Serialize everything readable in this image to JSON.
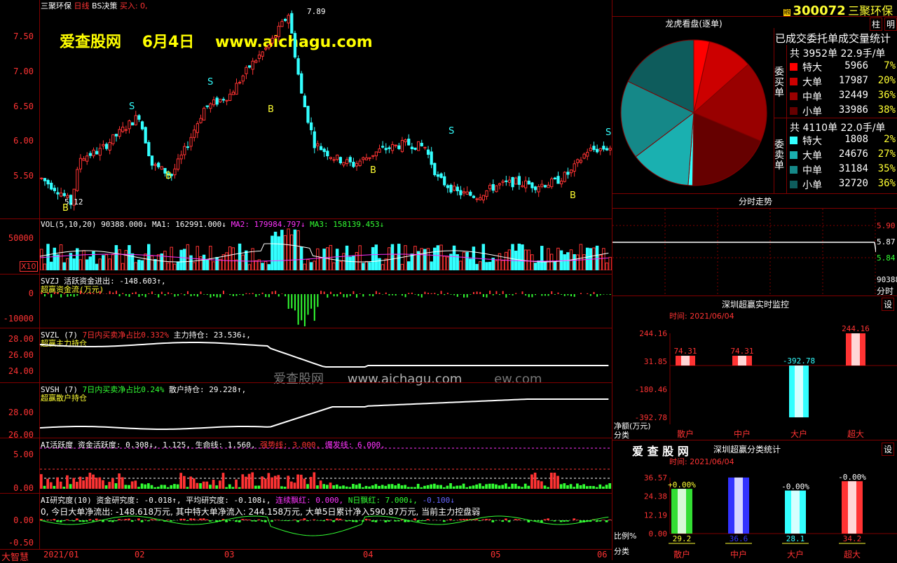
{
  "header": {
    "stock_name": "三聚环保",
    "period": "日线",
    "decision": "BS决策",
    "buy_signal": "买入: 0,",
    "watermark_title": "爱查股网",
    "watermark_date": "6月4日",
    "watermark_url": "www.aichagu.com",
    "center_watermark": "爱查股网",
    "center_watermark_url": "www.aichagu.com",
    "center_watermark_tail": "ew.com",
    "high_label": "7.89",
    "low_label": "5.12"
  },
  "main_chart": {
    "y_ticks": [
      "7.50",
      "7.00",
      "6.50",
      "6.00",
      "5.50"
    ],
    "signals_s": [
      "S",
      "S",
      "S",
      "S"
    ],
    "signals_b": [
      "B",
      "B",
      "B",
      "B",
      "B"
    ]
  },
  "vol_panel": {
    "name": "VOL(5,10,20)",
    "value": "90388.000↓",
    "ma1": "MA1: 162991.000↓",
    "ma2": "MA2: 179984.797↓",
    "ma3": "MA3: 158139.453↓",
    "y_ticks": [
      "50000"
    ],
    "unit": "X10"
  },
  "svzj_panel": {
    "name": "SVZJ",
    "line": "活跃资金进出: -148.603↑,",
    "sub": "超赢资金流(万元)",
    "y_ticks": [
      "0",
      "-10000"
    ]
  },
  "svzl_panel": {
    "name": "SVZL (7)",
    "line1": "7日内买卖净占比0.332%",
    "line2": "主力持仓: 23.536↓,",
    "sub": "超赢主力持仓",
    "y_ticks": [
      "28.00",
      "26.00",
      "24.00"
    ]
  },
  "svsh_panel": {
    "name": "SVSH (7)",
    "line1": "7日内买卖净占比0.24%",
    "line2": "散户持仓: 29.228↑,",
    "sub": "超赢散户持仓",
    "y_ticks": [
      "28.00",
      "26.00"
    ]
  },
  "ai_active": {
    "name": "AI活跃度",
    "v1": "资金活跃度: 0.308↓,",
    "v2": "1.125,",
    "v3": "生命线: 1.560,",
    "v4": "强势线: 3.000,",
    "v5": "爆发线: 6.000,",
    "y_ticks": [
      "5.00",
      "0.00"
    ]
  },
  "ai_research": {
    "name": "AI研究度(10)",
    "v1": "资金研究度: -0.018↑,",
    "v2": "平均研究度: -0.108↓,",
    "v3": "连续飘红: 0.000,",
    "v4": "N日飘红: 7.000↓,",
    "v5": "-0.100↓",
    "summary": "0, 今日大单净流出: -148.618万元, 其中特大单净流入: 244.158万元, 大单5日累计净入590.87万元, 当前主力控盘弱",
    "y_ticks": [
      "0.00",
      "-0.50"
    ]
  },
  "x_axis": {
    "corner": "大智慧",
    "labels": [
      "2021/01",
      "02",
      "03",
      "04",
      "05",
      "06"
    ]
  },
  "right_panel": {
    "code_badge": "融",
    "code": "300072",
    "name": "三聚环保",
    "tab1": "柱",
    "tab2": "明",
    "pie_title": "龙虎看盘(逐单)",
    "stat_title": "已成交委托单成交量统计",
    "buy_side_label": "委买单",
    "sell_side_label": "委卖单",
    "buy_total": "共 3952单 22.9手/单",
    "sell_total": "共 4110单 22.0手/单",
    "buy_rows": [
      {
        "label": "特大",
        "num": "5966",
        "pct": "7%",
        "color": "#ff0000"
      },
      {
        "label": "大单",
        "num": "17987",
        "pct": "20%",
        "color": "#cc0000"
      },
      {
        "label": "中单",
        "num": "32449",
        "pct": "36%",
        "color": "#990000"
      },
      {
        "label": "小单",
        "num": "33986",
        "pct": "38%",
        "color": "#660000"
      }
    ],
    "sell_rows": [
      {
        "label": "特大",
        "num": "1808",
        "pct": "2%",
        "color": "#33ffff"
      },
      {
        "label": "大单",
        "num": "24676",
        "pct": "27%",
        "color": "#1ab0b0"
      },
      {
        "label": "中单",
        "num": "31184",
        "pct": "35%",
        "color": "#158888"
      },
      {
        "label": "小单",
        "num": "32720",
        "pct": "36%",
        "color": "#0e5c5c"
      }
    ],
    "pie_slices": [
      {
        "value": 7,
        "color": "#ff0000"
      },
      {
        "value": 20,
        "color": "#cc0000"
      },
      {
        "value": 36,
        "color": "#990000"
      },
      {
        "value": 38,
        "color": "#660000"
      },
      {
        "value": 2,
        "color": "#33ffff"
      },
      {
        "value": 27,
        "color": "#1ab0b0"
      },
      {
        "value": 35,
        "color": "#158888"
      },
      {
        "value": 36,
        "color": "#0e5c5c"
      }
    ],
    "intraday_title": "分时走势",
    "intraday_y": [
      "5.90",
      "5.87",
      "5.84"
    ],
    "intraday_vol": "90388",
    "intraday_label": "分时",
    "monitor_title": "深圳超赢实时监控",
    "monitor_set": "设",
    "monitor_time": "时间: 2021/06/04",
    "monitor_y": [
      "244.16",
      "31.85",
      "-180.46",
      "-392.78"
    ],
    "monitor_unit": "净额(万元)",
    "monitor_cat_label": "分类",
    "monitor_bars": [
      {
        "label": "散户",
        "value": "74.31",
        "v": 74.31,
        "color": "#ff3333"
      },
      {
        "label": "中户",
        "value": "74.31",
        "v": 74.31,
        "color": "#ff3333"
      },
      {
        "label": "大户",
        "value": "-392.78",
        "v": -392.78,
        "color": "#33ffff"
      },
      {
        "label": "超大",
        "value": "244.16",
        "v": 244.16,
        "color": "#ff3333"
      }
    ],
    "class_logo": "爱 查 股 网",
    "class_title": "深圳超赢分类统计",
    "class_set": "设",
    "class_time": "时间: 2021/06/04",
    "class_y": [
      "36.57",
      "24.38",
      "12.19",
      "0.00"
    ],
    "class_ratio_label": "比例%",
    "class_cat_label": "分类",
    "class_bars": [
      {
        "label": "散户",
        "top": "+0.00%",
        "bottom": "29.2",
        "v": 29.2,
        "color": "#33dd33"
      },
      {
        "label": "中户",
        "top": "",
        "bottom": "36.6",
        "v": 36.6,
        "color": "#3333ff"
      },
      {
        "label": "大户",
        "top": "-0.00%",
        "bottom": "28.1",
        "v": 28.1,
        "color": "#33ffff"
      },
      {
        "label": "超大",
        "top": "-0.00%",
        "bottom": "34.2",
        "v": 34.2,
        "color": "#ff3333"
      }
    ]
  }
}
